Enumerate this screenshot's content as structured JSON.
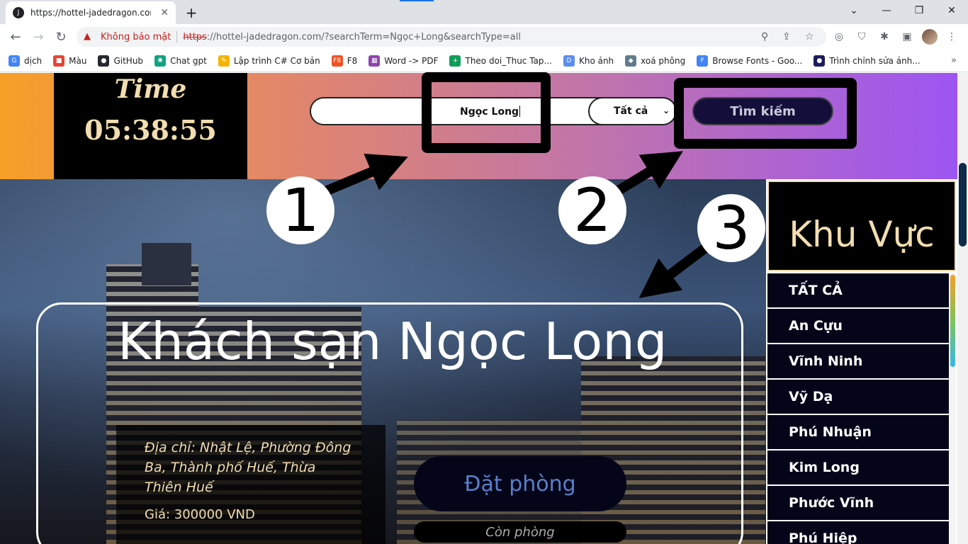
{
  "browser": {
    "tab_title": "https://hottel-jadedragon.com/?s",
    "favicon_letter": "J",
    "not_secure": "Không bảo mật",
    "url_scheme": "https",
    "url_rest": "://hottel-jadedragon.com/?searchTerm=Ngọc+Long&searchType=all",
    "bookmarks": [
      {
        "label": "dịch",
        "color": "#4285f4",
        "glyph": "G"
      },
      {
        "label": "Màu",
        "color": "#e94235",
        "glyph": "■"
      },
      {
        "label": "GitHub",
        "color": "#24292f",
        "glyph": "●"
      },
      {
        "label": "Chat gpt",
        "color": "#10a37f",
        "glyph": "✺"
      },
      {
        "label": "Lập trình C# Cơ bản",
        "color": "#f4b400",
        "glyph": "✎"
      },
      {
        "label": "F8",
        "color": "#f05123",
        "glyph": "F8"
      },
      {
        "label": "Word -> PDF",
        "color": "#8e44ad",
        "glyph": "▦"
      },
      {
        "label": "Theo doi_Thuc Tap...",
        "color": "#0f9d58",
        "glyph": "+"
      },
      {
        "label": "Kho ảnh",
        "color": "#5b8def",
        "glyph": "D"
      },
      {
        "label": "xoá phông",
        "color": "#607d8b",
        "glyph": "◆"
      },
      {
        "label": "Browse Fonts - Goo...",
        "color": "#4285f4",
        "glyph": "F"
      },
      {
        "label": "Trình chỉnh sửa ảnh...",
        "color": "#1c1c5c",
        "glyph": "●"
      }
    ]
  },
  "header": {
    "time_label": "Time",
    "time_value": "05:38:55",
    "search_value": "Ngọc Long",
    "search_type": "Tất cả",
    "search_button": "Tìm kiếm"
  },
  "annotations": [
    "1",
    "2",
    "3"
  ],
  "hotel": {
    "name": "Khách sạn Ngọc Long",
    "address": "Địa chỉ: Nhật Lệ, Phường Đông Ba, Thành phố Huế, Thừa Thiên Huế",
    "price": "Giá: 300000 VND",
    "book_button": "Đặt phòng",
    "status": "Còn phòng"
  },
  "sidebar": {
    "title": "Khu Vực",
    "areas": [
      "TẤT CẢ",
      "An Cựu",
      "Vĩnh Ninh",
      "Vỹ Dạ",
      "Phú Nhuận",
      "Kim Long",
      "Phước Vĩnh",
      "Phú Hiệp"
    ]
  }
}
